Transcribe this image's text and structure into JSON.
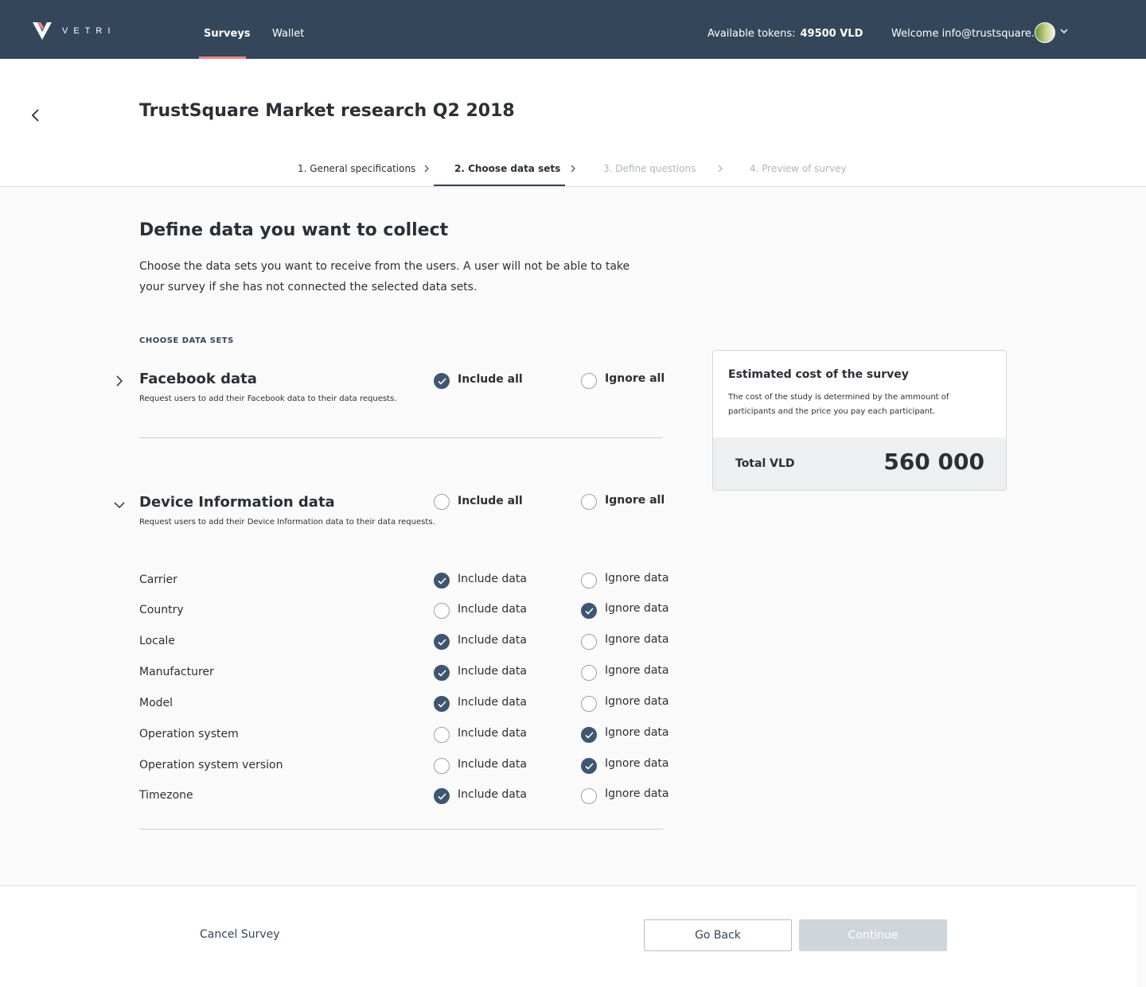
{
  "app": {
    "brand": "VETRI",
    "logo_icon": "vetri-logo-icon"
  },
  "nav": {
    "items": [
      {
        "label": "Surveys",
        "active": true
      },
      {
        "label": "Wallet",
        "active": false
      }
    ]
  },
  "account": {
    "tokens_label": "Available tokens:",
    "tokens_value": "49500 VLD",
    "welcome": "Welcome info@trustsquare.ch"
  },
  "page": {
    "title": "TrustSquare Market research Q2 2018"
  },
  "steps": [
    {
      "label": "1. General specifications",
      "state": "done"
    },
    {
      "label": "2. Choose data sets",
      "state": "active"
    },
    {
      "label": "3. Define questions",
      "state": "disabled"
    },
    {
      "label": "4. Preview of survey",
      "state": "disabled"
    }
  ],
  "section": {
    "title": "Define data you want to collect",
    "description": "Choose the data sets you want to receive from the users. A user will not be able to take your survey if she has not connected the selected data sets.",
    "choose_label": "CHOOSE DATA SETS"
  },
  "groups": [
    {
      "title": "Facebook data",
      "description": "Request users to add their Facebook data to their data requests.",
      "expanded": false,
      "include_all_label": "Include all",
      "ignore_all_label": "Ignore all",
      "selection": "include"
    },
    {
      "title": "Device Information data",
      "description": "Request users to add their Device Information data to their data requests.",
      "expanded": true,
      "include_all_label": "Include all",
      "ignore_all_label": "Ignore all",
      "selection": "none"
    }
  ],
  "device_rows": {
    "include_label": "Include data",
    "ignore_label": "Ignore data",
    "rows": [
      {
        "label": "Carrier",
        "selection": "include"
      },
      {
        "label": "Country",
        "selection": "ignore"
      },
      {
        "label": "Locale",
        "selection": "include"
      },
      {
        "label": "Manufacturer",
        "selection": "include"
      },
      {
        "label": "Model",
        "selection": "include"
      },
      {
        "label": "Operation system",
        "selection": "ignore"
      },
      {
        "label": "Operation system version",
        "selection": "ignore"
      },
      {
        "label": "Timezone",
        "selection": "include"
      }
    ]
  },
  "cost": {
    "title": "Estimated cost of the survey",
    "description": "The cost of the study is determined by the ammount of participants and the price you pay each participant.",
    "total_label": "Total VLD",
    "total_value": "560 000"
  },
  "footer": {
    "cancel": "Cancel Survey",
    "go_back": "Go Back",
    "continue": "Continue",
    "continue_enabled": false
  },
  "colors": {
    "topbar": "#344659",
    "accent_underline": "#e8868d",
    "radio_checked": "#3f5670"
  }
}
